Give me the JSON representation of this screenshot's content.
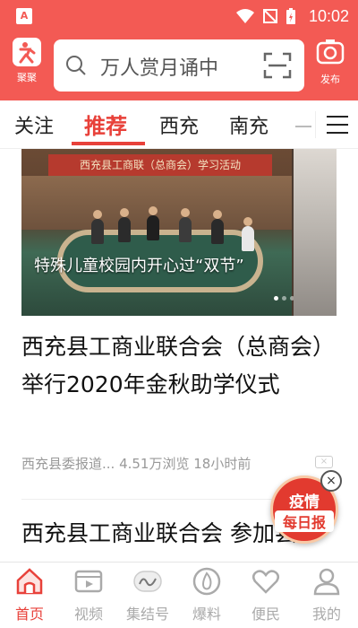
{
  "status_bar": {
    "app_badge": "A",
    "time": "10:02"
  },
  "header": {
    "logo_label": "聚聚",
    "search_placeholder": "万人赏月诵中",
    "publish_label": "发布"
  },
  "tabs": [
    {
      "label": "关注"
    },
    {
      "label": "推荐"
    },
    {
      "label": "西充"
    },
    {
      "label": "南充"
    }
  ],
  "banner": {
    "board_text": "西充县工商联（总商会）学习活动",
    "caption": "特殊儿童校园内开心过“双节”"
  },
  "articles": [
    {
      "title": "西充县工商业联合会（总商会） 举行2020年金秋助学仪式",
      "meta": "西充县委报道... 4.51万浏览 18小时前"
    },
    {
      "title": "西充县工商业联合会 参加县"
    }
  ],
  "badge": {
    "line1": "疫情",
    "line2": "每日报"
  },
  "bottom_nav": [
    {
      "label": "首页",
      "icon": "home-icon"
    },
    {
      "label": "视频",
      "icon": "video-icon"
    },
    {
      "label": "集结号",
      "icon": "assembly-icon"
    },
    {
      "label": "爆料",
      "icon": "fire-icon"
    },
    {
      "label": "便民",
      "icon": "heart-icon"
    },
    {
      "label": "我的",
      "icon": "user-icon"
    }
  ],
  "colors": {
    "brand": "#f35a54",
    "accent": "#e8413a"
  }
}
